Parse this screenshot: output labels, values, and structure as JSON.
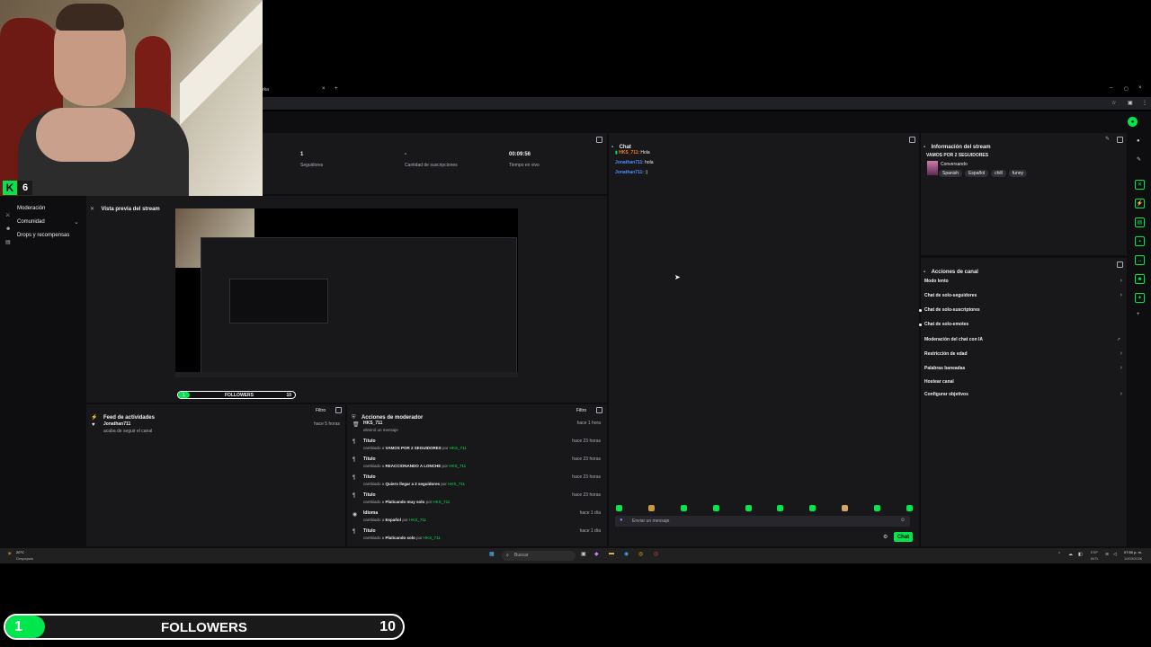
{
  "browser": {
    "tab_title": "rka",
    "new_tab": "+"
  },
  "webcam": {
    "badge_letter": "K",
    "badge_number": "6"
  },
  "sidebar": {
    "items": [
      {
        "label": "Moderación",
        "icon": "sword-icon"
      },
      {
        "label": "Comunidad",
        "icon": "people-icon"
      },
      {
        "label": "Drops y recompensas",
        "icon": "gift-icon"
      }
    ]
  },
  "stats": [
    {
      "value": "1",
      "label": "Seguidores"
    },
    {
      "value": "-",
      "label": "Cantidad de suscripciones"
    },
    {
      "value": "00:09:56",
      "label": "Tiempo en vivo"
    }
  ],
  "preview": {
    "title": "Vista previa del stream",
    "followers_bar": {
      "current": "1",
      "label": "FOLLOWERS",
      "goal": "10",
      "progress": 0.1
    }
  },
  "activity": {
    "title": "Feed de actividades",
    "filter": "Filtro",
    "items": [
      {
        "user": "Jonathan711",
        "time": "hace 5 horas",
        "text": "acaba de seguir el canal"
      }
    ]
  },
  "mod_actions": {
    "title": "Acciones de moderador",
    "filter": "Filtro",
    "items": [
      {
        "title": "HKS_711",
        "time": "hace 1 hora",
        "pre": "eliminó un mensaje",
        "value": "",
        "by": "",
        "user": ""
      },
      {
        "title": "Título",
        "time": "hace 23 horas",
        "pre": "cambiado a",
        "value": "VAMOS POR 2 SEGUIDORES",
        "by": "por",
        "user": "HKS_711"
      },
      {
        "title": "Título",
        "time": "hace 23 horas",
        "pre": "cambiado a",
        "value": "REACCIONANDO A LONCHE",
        "by": "por",
        "user": "HKS_711"
      },
      {
        "title": "Título",
        "time": "hace 23 horas",
        "pre": "cambiado a",
        "value": "Quiero llegar a 2 seguidores",
        "by": "por",
        "user": "HKS_711"
      },
      {
        "title": "Título",
        "time": "hace 23 horas",
        "pre": "cambiado a",
        "value": "Platicando muy solo",
        "by": "por",
        "user": "HKS_711"
      },
      {
        "title": "Idioma",
        "time": "hace 1 día",
        "pre": "cambiado a",
        "value": "Español",
        "by": "por",
        "user": "HKS_711"
      },
      {
        "title": "Título",
        "time": "hace 1 día",
        "pre": "cambiado a",
        "value": "Platicando solo",
        "by": "por",
        "user": "HKS_711"
      }
    ]
  },
  "chat": {
    "title": "Chat",
    "messages": [
      {
        "user": "HKS_711",
        "text": "Hola",
        "color": "#ff7f24"
      },
      {
        "user": "Jonathan711",
        "text": "hola",
        "color": "#4f8cff"
      },
      {
        "user": "Jonathan711",
        "text": ":)",
        "color": "#4f8cff"
      }
    ],
    "input_placeholder": "Enviar un mensaje",
    "send_label": "Chat"
  },
  "stream_info": {
    "title": "Información del stream",
    "stream_title": "VAMOS POR 2 SEGUIDORES",
    "category": "Conversando",
    "tags": [
      "Spanish",
      "Español",
      "chill",
      "funny"
    ]
  },
  "channel_actions": {
    "title": "Acciones de canal",
    "items": [
      {
        "label": "Modo lento",
        "control": "chevron"
      },
      {
        "label": "Chat de solo-seguidores",
        "control": "chevron"
      },
      {
        "label": "Chat de solo-suscriptores",
        "control": "toggle"
      },
      {
        "label": "Chat de solo-emotes",
        "control": "toggle"
      },
      {
        "label": "Moderación del chat con IA",
        "control": "external"
      },
      {
        "label": "Restricción de edad",
        "control": "chevron"
      },
      {
        "label": "Palabras baneadas",
        "control": "chevron"
      },
      {
        "label": "Hostear canal",
        "control": "none"
      },
      {
        "label": "Configurar objetivos",
        "control": "chevron"
      }
    ]
  },
  "taskbar": {
    "weather_temp": "20°C",
    "weather_desc": "Despejado",
    "search_placeholder": "Buscar",
    "lang_top": "ESP",
    "lang_bottom": "INTL",
    "time": "07:50 p. m.",
    "date": "10/03/2026"
  },
  "overlay_followers": {
    "current": "1",
    "label": "FOLLOWERS",
    "goal": "10",
    "progress": 0.1
  },
  "colors": {
    "accent": "#00e64d",
    "panel": "#18181b",
    "bg": "#0e0e10"
  }
}
